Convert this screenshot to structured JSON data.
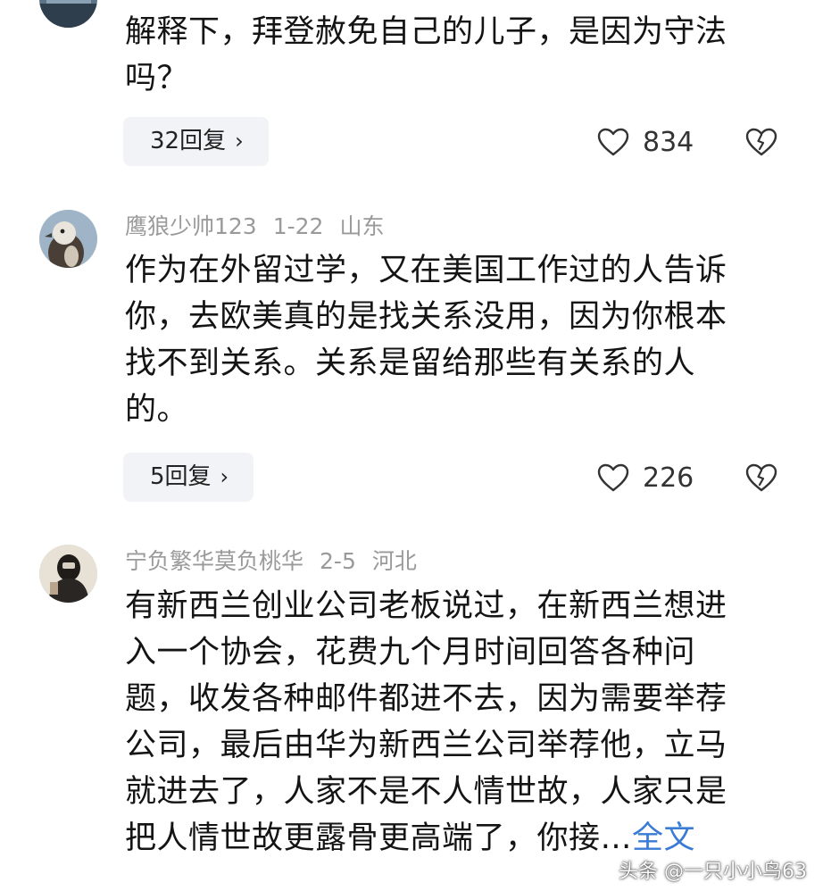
{
  "comments": [
    {
      "lines": [
        "解释下，拜登赦免自己的儿子，是因为守法",
        "吗？"
      ],
      "replies_label": "32回复",
      "likes": "834",
      "icons": {
        "like": "heart-icon",
        "dislike": "broken-heart-icon",
        "chevron": "chevron-right-icon"
      }
    },
    {
      "username": "鹰狼少帅123",
      "date": "1-22",
      "location": "山东",
      "lines": [
        "作为在外留过学，又在美国工作过的人告诉",
        "你，去欧美真的是找关系没用，因为你根本",
        "找不到关系。关系是留给那些有关系的人",
        "的。"
      ],
      "replies_label": "5回复",
      "likes": "226"
    },
    {
      "username": "宁负繁华莫负桃华",
      "date": "2-5",
      "location": "河北",
      "lines": [
        "有新西兰创业公司老板说过，在新西兰想进",
        "入一个协会，花费九个月时间回答各种问",
        "题，收发各种邮件都进不去，因为需要举荐",
        "公司，最后由华为新西兰公司举荐他，立马",
        "就进去了，人家不是不人情世故，人家只是",
        "把人情世故更露骨更高端了，你接"
      ],
      "full_text_link": "全文"
    }
  ],
  "watermark": "头条 @一只小小鸟63",
  "colors": {
    "link": "#3a7bd5",
    "meta": "#9a9a9a",
    "reply_bg": "#f2f3f6"
  }
}
